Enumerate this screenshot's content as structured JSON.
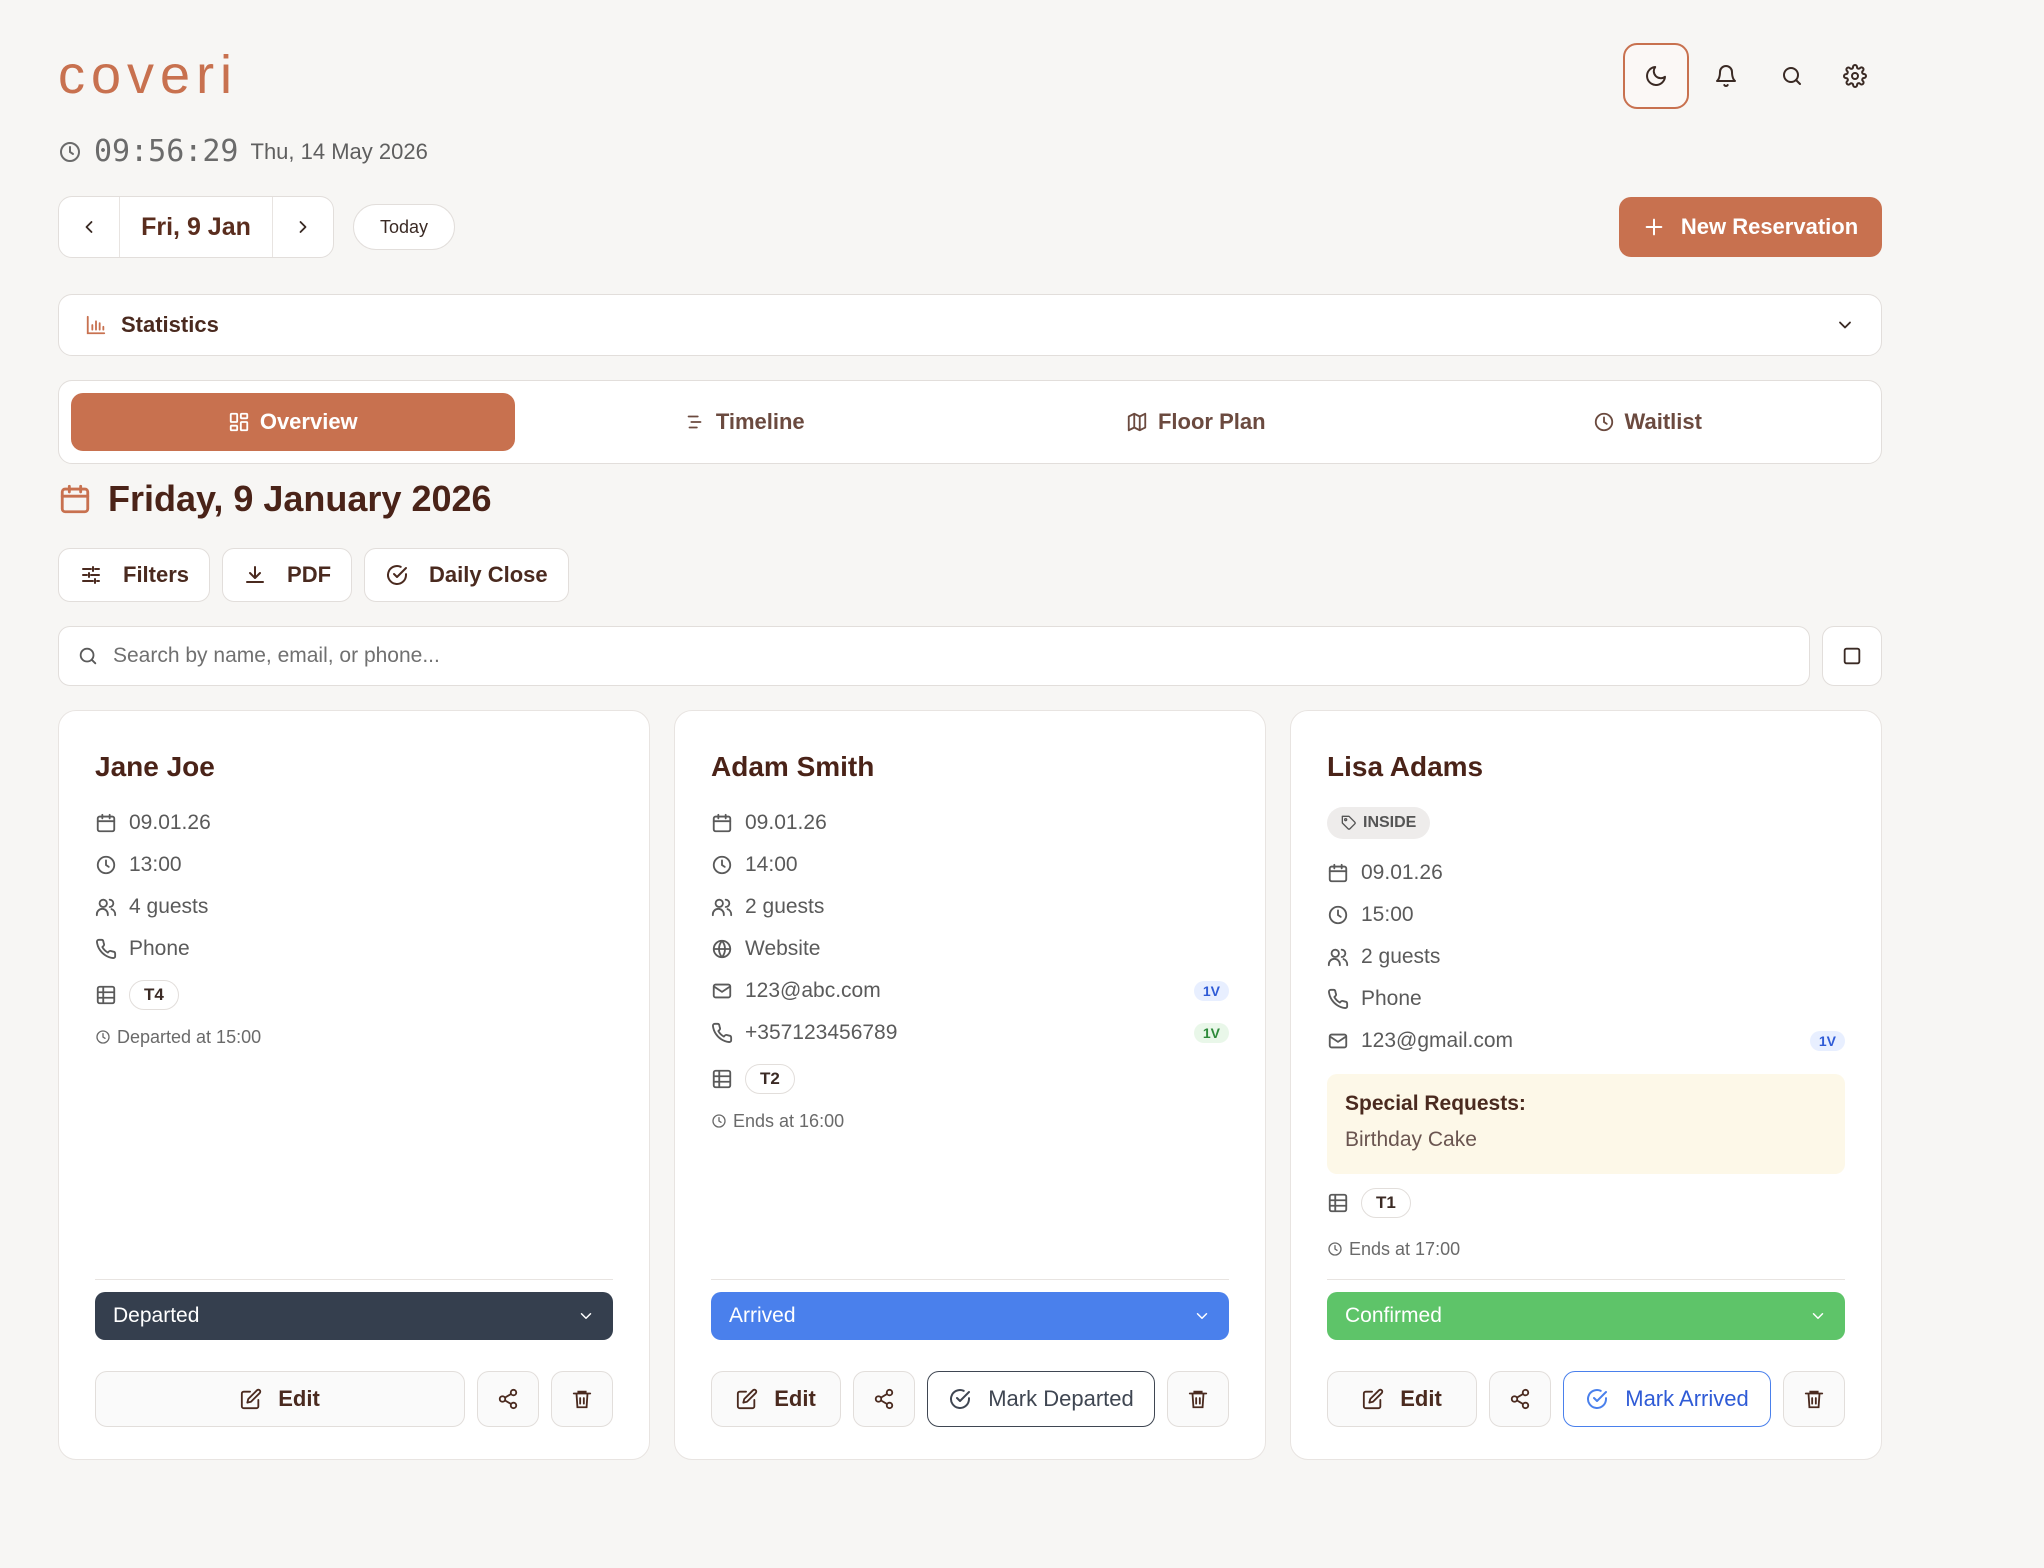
{
  "app": {
    "logo": "coveri"
  },
  "header": {
    "theme_icon": "moon-icon",
    "notifications_icon": "bell-icon",
    "search_icon": "search-icon",
    "settings_icon": "gear-icon"
  },
  "clock": {
    "time": "09:56:29",
    "date": "Thu, 14 May 2026"
  },
  "date_nav": {
    "label": "Fri, 9 Jan",
    "today": "Today"
  },
  "new_reservation": "New Reservation",
  "statistics": {
    "label": "Statistics"
  },
  "tabs": [
    {
      "label": "Overview",
      "icon": "grid-icon"
    },
    {
      "label": "Timeline",
      "icon": "timeline-icon"
    },
    {
      "label": "Floor Plan",
      "icon": "map-icon"
    },
    {
      "label": "Waitlist",
      "icon": "clock-icon"
    }
  ],
  "active_tab": "Overview",
  "day_title": "Friday, 9 January 2026",
  "actions": {
    "filters": "Filters",
    "pdf": "PDF",
    "daily_close": "Daily Close"
  },
  "search": {
    "placeholder": "Search by name, email, or phone..."
  },
  "colors": {
    "accent": "#c8714f",
    "departed": "#353f4e",
    "arrived": "#4a80ec",
    "confirmed": "#5ec469"
  },
  "cards": [
    {
      "name": "Jane Joe",
      "date": "09.01.26",
      "time": "13:00",
      "guests": "4 guests",
      "source": "Phone",
      "table": "T4",
      "note": "Departed at 15:00",
      "status": "Departed",
      "edit": "Edit"
    },
    {
      "name": "Adam Smith",
      "date": "09.01.26",
      "time": "14:00",
      "guests": "2 guests",
      "source": "Website",
      "email": "123@abc.com",
      "email_badge": "1V",
      "phone": "+357123456789",
      "phone_badge": "1V",
      "table": "T2",
      "note": "Ends at 16:00",
      "status": "Arrived",
      "edit": "Edit",
      "action": "Mark Departed"
    },
    {
      "name": "Lisa Adams",
      "tag": "INSIDE",
      "date": "09.01.26",
      "time": "15:00",
      "guests": "2 guests",
      "source": "Phone",
      "email": "123@gmail.com",
      "email_badge": "1V",
      "special_requests_label": "Special Requests:",
      "special_requests": "Birthday Cake",
      "table": "T1",
      "note": "Ends at 17:00",
      "status": "Confirmed",
      "edit": "Edit",
      "action": "Mark Arrived"
    }
  ]
}
